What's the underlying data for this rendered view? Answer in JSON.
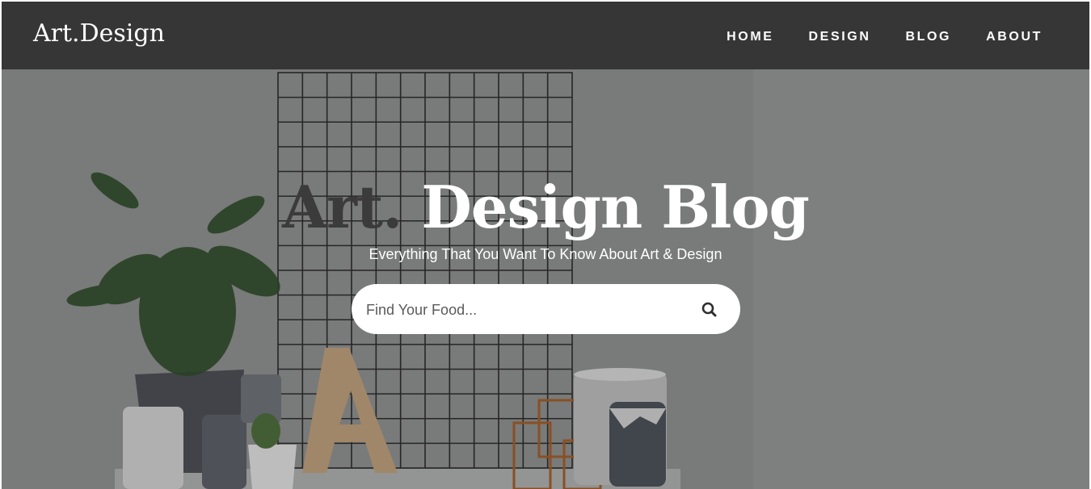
{
  "brand": {
    "name": "Art.Design"
  },
  "nav": {
    "items": [
      {
        "label": "HOME"
      },
      {
        "label": "DESIGN"
      },
      {
        "label": "BLOG"
      },
      {
        "label": "ABOUT"
      }
    ]
  },
  "hero": {
    "title_part1": "Art.",
    "title_part2": " Design Blog",
    "subtitle": "Everything That You Want To Know About Art & Design"
  },
  "search": {
    "placeholder": "Find Your Food...",
    "value": "",
    "icon": "search-icon"
  },
  "colors": {
    "navbar": "#363636",
    "overlay": "#8d8e8e",
    "text_light": "#ffffff",
    "text_dark": "#3b3b3b"
  }
}
